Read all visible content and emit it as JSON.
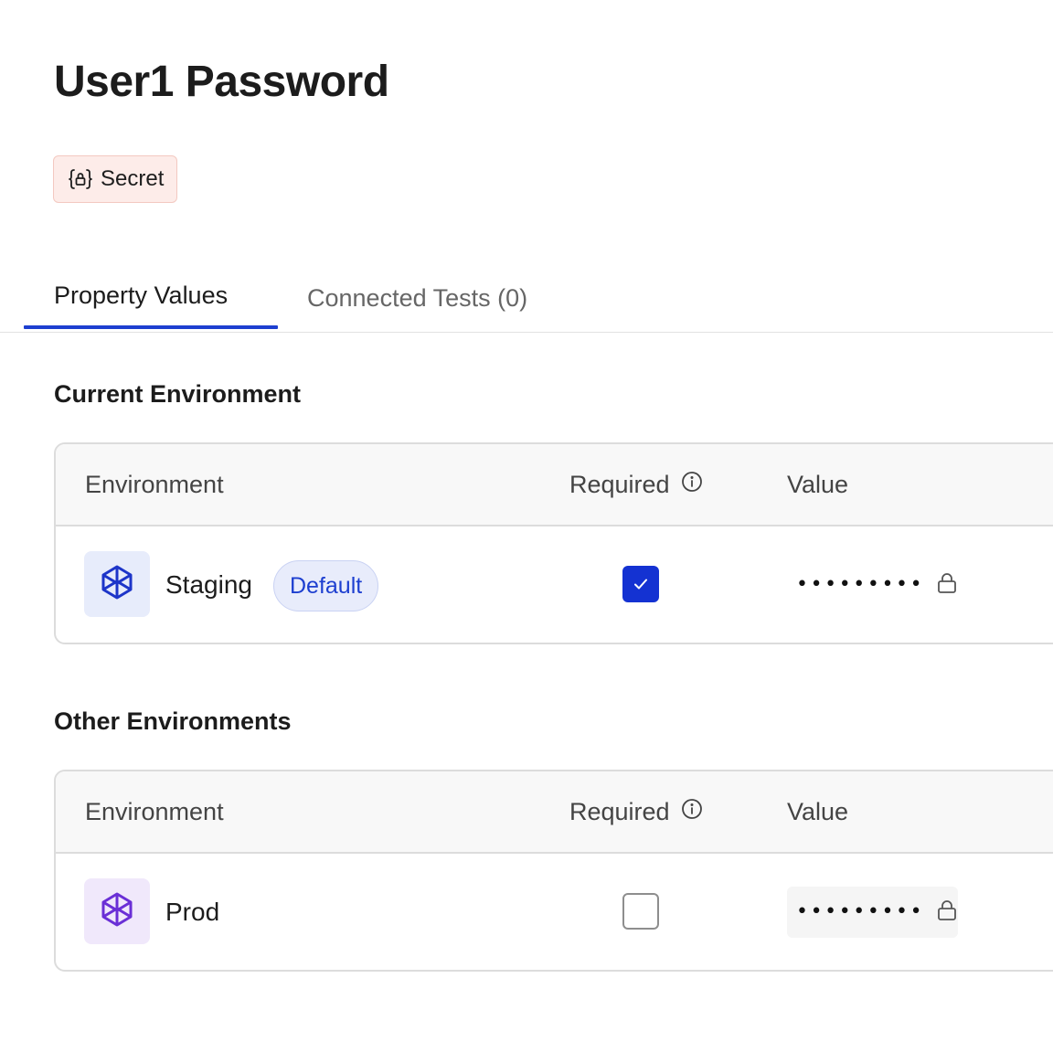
{
  "page": {
    "title": "User1 Password"
  },
  "badge": {
    "label": "Secret",
    "icon": "lock-braces-icon"
  },
  "tabs": [
    {
      "label": "Property Values",
      "active": true
    },
    {
      "label": "Connected Tests (0)",
      "active": false
    }
  ],
  "sections": {
    "current": {
      "heading": "Current Environment",
      "columns": {
        "environment": "Environment",
        "required": "Required",
        "value": "Value"
      },
      "rows": [
        {
          "name": "Staging",
          "badge": "Default",
          "required": true,
          "value_masked": "•••••••••",
          "icon": "cube-icon",
          "icon_color": "#1d35c9"
        }
      ]
    },
    "other": {
      "heading": "Other Environments",
      "columns": {
        "environment": "Environment",
        "required": "Required",
        "value": "Value"
      },
      "rows": [
        {
          "name": "Prod",
          "required": false,
          "value_masked": "•••••••••",
          "icon": "cube-icon",
          "icon_color": "#6a2fd6"
        }
      ]
    }
  },
  "colors": {
    "accent": "#1d3fd0",
    "secret_badge_bg": "#fdece9",
    "checkbox_checked": "#1432d2"
  }
}
